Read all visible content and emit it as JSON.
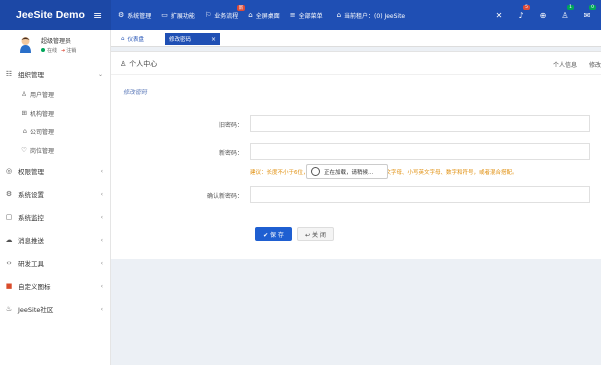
{
  "brand": {
    "title": "JeeSite Demo"
  },
  "topnav": [
    {
      "icon": "gear-icon",
      "glyph": "⚙",
      "label": "系统管理"
    },
    {
      "icon": "monitor-icon",
      "glyph": "▭",
      "label": "扩展功能"
    },
    {
      "icon": "flag-icon",
      "glyph": "⚐",
      "label": "业务流程",
      "badge": "新"
    },
    {
      "icon": "home-icon",
      "glyph": "⌂",
      "label": "全屏桌面"
    },
    {
      "icon": "list-icon",
      "glyph": "≡",
      "label": "全部菜单"
    },
    {
      "icon": "home-icon",
      "glyph": "⌂",
      "label": "当前租户：(0) JeeSite"
    }
  ],
  "righticons": [
    {
      "name": "fullscreen-icon",
      "glyph": "✕",
      "badge": ""
    },
    {
      "name": "bell-icon",
      "glyph": "♪",
      "badge": "5"
    },
    {
      "name": "globe-icon",
      "glyph": "⊕",
      "badge": ""
    },
    {
      "name": "user-icon",
      "glyph": "♙",
      "badge": "1"
    },
    {
      "name": "message-icon",
      "glyph": "✉",
      "badge": "0"
    }
  ],
  "user": {
    "name": "超级管理员",
    "status": "在线",
    "logout": "注销"
  },
  "sidebar": {
    "items": [
      {
        "label": "组织管理",
        "icon": "org-icon",
        "glyph": "☷",
        "chev": "⌄",
        "type": "menu"
      },
      {
        "label": "用户管理",
        "icon": "user-icon",
        "glyph": "♙",
        "type": "sub"
      },
      {
        "label": "机构管理",
        "icon": "sitemap-icon",
        "glyph": "⊞",
        "type": "sub"
      },
      {
        "label": "公司管理",
        "icon": "building-icon",
        "glyph": "⌂",
        "type": "sub"
      },
      {
        "label": "岗位管理",
        "icon": "badge-icon",
        "glyph": "♡",
        "type": "sub"
      },
      {
        "label": "权限管理",
        "icon": "shield-icon",
        "glyph": "◎",
        "chev": "‹",
        "type": "menu"
      },
      {
        "label": "系统设置",
        "icon": "gear-icon",
        "glyph": "⚙",
        "chev": "‹",
        "type": "menu"
      },
      {
        "label": "系统监控",
        "icon": "monitor-icon",
        "glyph": "▢",
        "chev": "‹",
        "type": "menu"
      },
      {
        "label": "消息推送",
        "icon": "chat-icon",
        "glyph": "☁",
        "chev": "‹",
        "type": "menu"
      },
      {
        "label": "研发工具",
        "icon": "code-icon",
        "glyph": "‹›",
        "chev": "‹",
        "type": "menu"
      },
      {
        "label": "自定义图标",
        "icon": "custom-icon",
        "glyph": "■",
        "chev": "‹",
        "type": "menu"
      },
      {
        "label": "JeeSite社区",
        "icon": "community-icon",
        "glyph": "♨",
        "chev": "‹",
        "type": "menu"
      }
    ]
  },
  "tabs": {
    "home": "仪表盘",
    "active": "修改密码",
    "close": "×"
  },
  "box": {
    "title": "个人中心",
    "tabs": [
      "个人信息",
      "修改"
    ]
  },
  "form": {
    "section": "修改密码",
    "old_label": "旧密码：",
    "new_label": "新密码：",
    "confirm_label": "确认新密码：",
    "hint": "建议：长度不小于6位，需包含数字、小写字母、大写英文字母、小写英文字母、数字和符号，或者混合搭配。",
    "loading": "正在加载，请稍候...",
    "save": "✔ 保 存",
    "close": "↩ 关 闭"
  },
  "colors": {
    "header": "#1f4fb4",
    "accent": "#1f5fd1",
    "hint": "#e08e0b"
  }
}
